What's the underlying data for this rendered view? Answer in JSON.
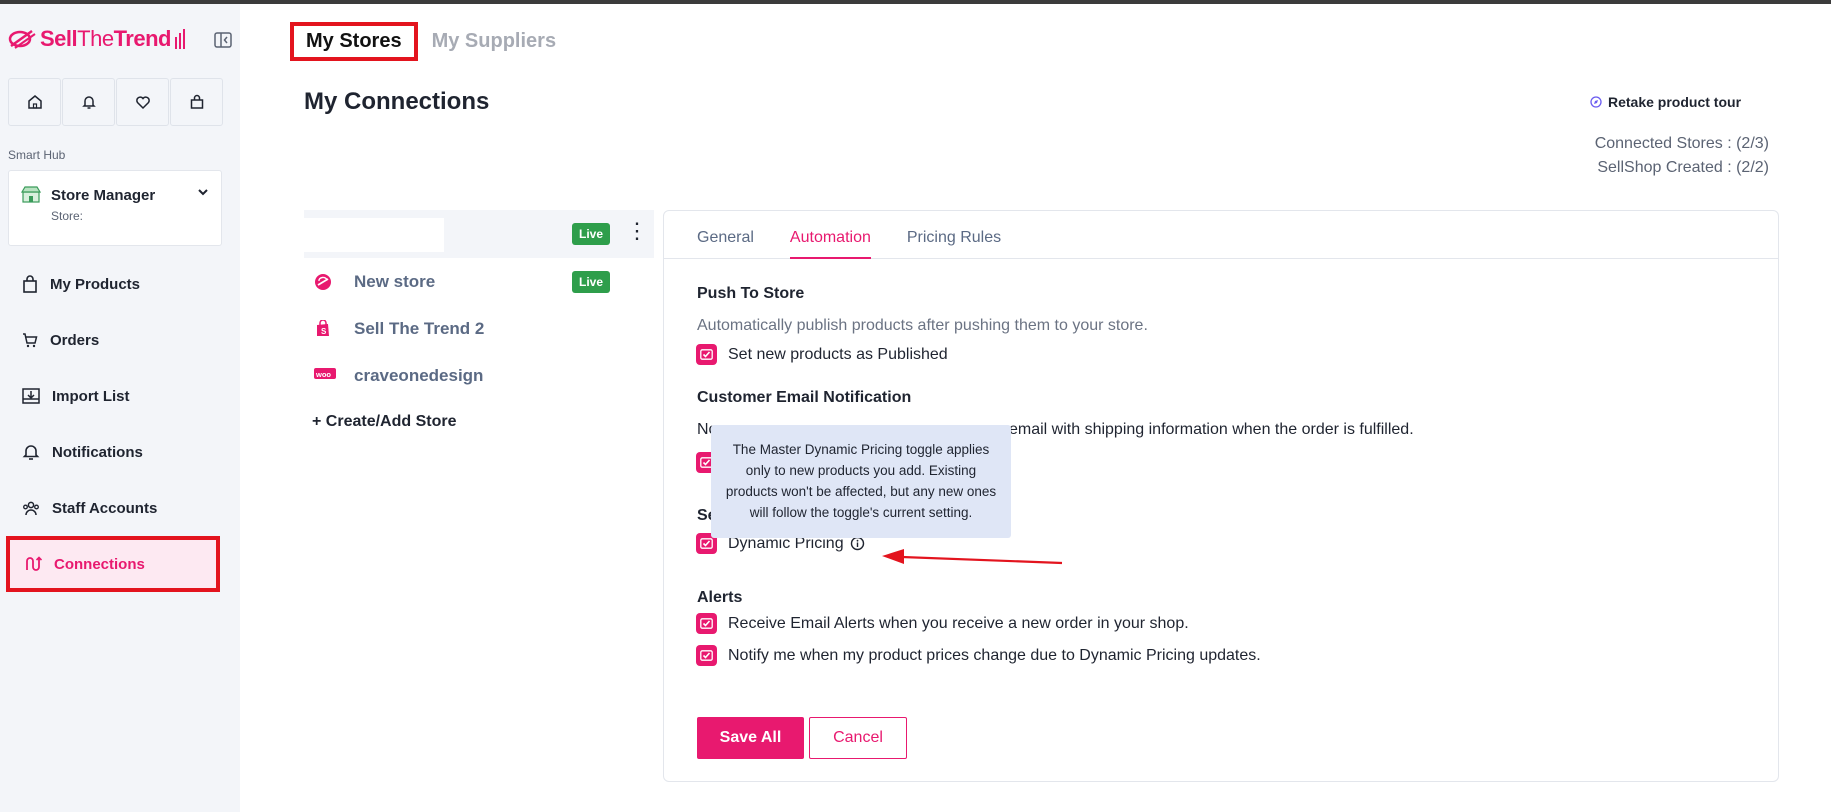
{
  "app": {
    "logo_text_a": "Sell",
    "logo_text_b": "The",
    "logo_text_c": "Trend",
    "accent": "#e8196f"
  },
  "sidebar": {
    "quick_icons": [
      "home-icon",
      "bell-icon",
      "heart-icon",
      "bag-icon"
    ],
    "smart_hub_label": "Smart Hub",
    "store_manager": {
      "title": "Store Manager",
      "subtitle": "Store:"
    },
    "items": [
      {
        "label": "My Products",
        "icon": "bag-icon"
      },
      {
        "label": "Orders",
        "icon": "cart-icon"
      },
      {
        "label": "Import List",
        "icon": "import-icon"
      },
      {
        "label": "Notifications",
        "icon": "bell-icon"
      },
      {
        "label": "Staff Accounts",
        "icon": "users-icon"
      },
      {
        "label": "Connections",
        "icon": "connections-icon",
        "active": true
      }
    ]
  },
  "main": {
    "tabs": [
      {
        "label": "My Stores",
        "active": true
      },
      {
        "label": "My Suppliers",
        "active": false
      }
    ],
    "page_title": "My Connections",
    "tour_label": "Retake product tour",
    "connected_stores": "Connected Stores : (2/3)",
    "sellshop_created": "SellShop Created : (2/2)"
  },
  "stores": {
    "selected_badge": "Live",
    "list": [
      {
        "name": "New store",
        "badge": "Live",
        "icon": "sellthetrend-icon"
      },
      {
        "name": "Sell The Trend 2",
        "badge": "",
        "icon": "shopify-icon"
      },
      {
        "name": "craveonedesign",
        "badge": "",
        "icon": "woocommerce-icon"
      }
    ],
    "create_label": "+ Create/Add Store"
  },
  "panel": {
    "tabs": [
      {
        "label": "General",
        "active": false
      },
      {
        "label": "Automation",
        "active": true
      },
      {
        "label": "Pricing Rules",
        "active": false
      }
    ],
    "push_title": "Push To Store",
    "push_desc": "Automatically publish products after pushing them to your store.",
    "push_check": "Set new products as Published",
    "email_title": "Customer Email Notification",
    "email_desc_a": "No",
    "email_desc_b": "email with shipping information when the order is fulfilled.",
    "section3_title_partial": "Se",
    "dynamic_check": "Dynamic Pricing",
    "alerts_title": "Alerts",
    "alert_1": "Receive Email Alerts when you receive a new order in your shop.",
    "alert_2": "Notify me when my product prices change due to Dynamic Pricing updates.",
    "save_label": "Save All",
    "cancel_label": "Cancel"
  },
  "tooltip": {
    "text": "The Master Dynamic Pricing toggle applies only to new products you add. Existing products won't be affected, but any new ones will follow the toggle's current setting."
  }
}
